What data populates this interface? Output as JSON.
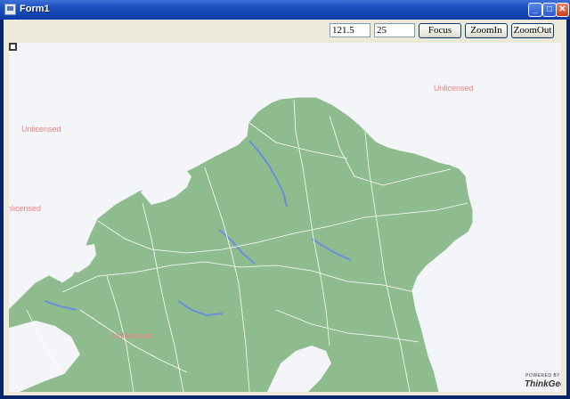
{
  "window": {
    "title": "Form1",
    "minimize_glyph": "_",
    "maximize_glyph": "□",
    "close_glyph": "✕"
  },
  "toolbar": {
    "longitude_value": "121.5",
    "latitude_value": "25",
    "focus_label": "Focus",
    "zoom_in_label": "ZoomIn",
    "zoom_out_label": "ZoomOut"
  },
  "map": {
    "watermarks": [
      "Unlicensed",
      "Unlicensed",
      "nlicensed",
      "Unlicensed"
    ],
    "powered_by": "POWERED BY",
    "brand": "ThinkGeo",
    "land_color": "#8fbc8f",
    "water_color": "#6a8fd8",
    "boundary_color": "#ffffff"
  }
}
